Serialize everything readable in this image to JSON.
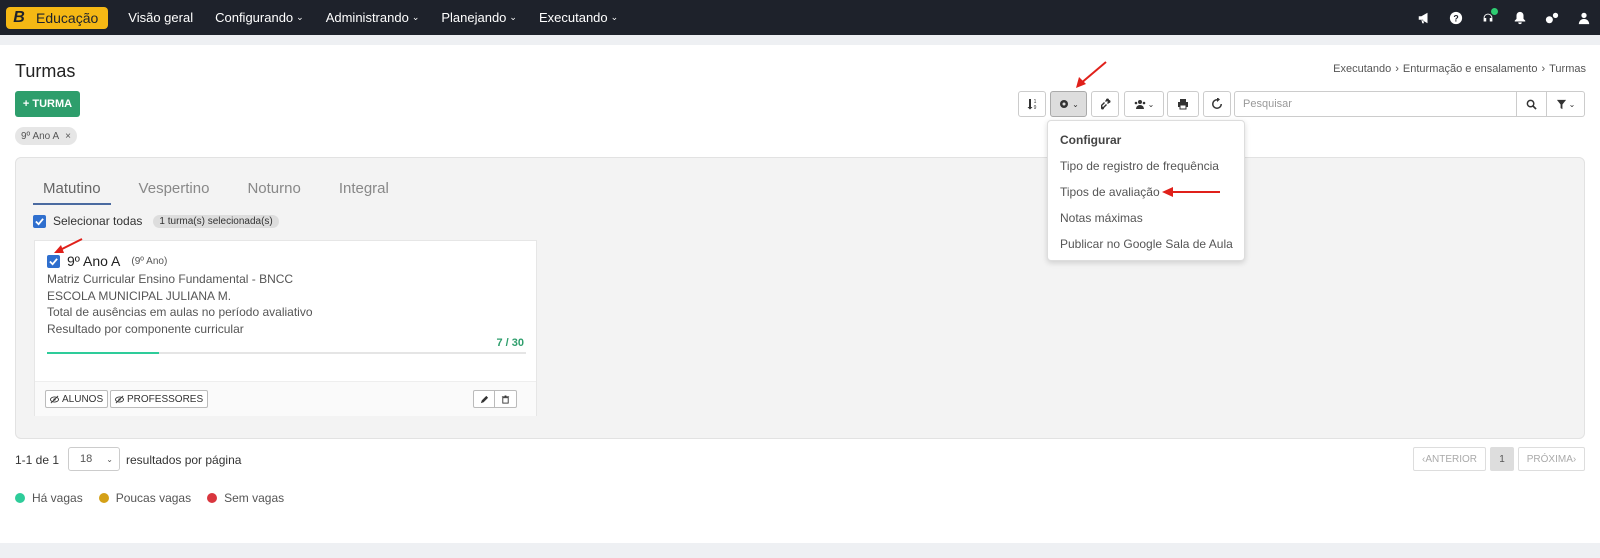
{
  "nav": {
    "logo": "Educação",
    "items": [
      {
        "label": "Visão geral",
        "dropdown": false
      },
      {
        "label": "Configurando",
        "dropdown": true
      },
      {
        "label": "Administrando",
        "dropdown": true
      },
      {
        "label": "Planejando",
        "dropdown": true
      },
      {
        "label": "Executando",
        "dropdown": true
      }
    ],
    "icons": [
      "megaphone-icon",
      "help-icon",
      "support-icon",
      "bell-icon",
      "settings-icon",
      "user-icon"
    ]
  },
  "page": {
    "title": "Turmas",
    "breadcrumb": [
      "Executando",
      "Enturmação e ensalamento",
      "Turmas"
    ],
    "add_button": "TURMA",
    "filter_chip": "9º Ano A"
  },
  "toolbar": {
    "search_placeholder": "Pesquisar"
  },
  "dropdown": {
    "header": "Configurar",
    "items": [
      "Tipo de registro de frequência",
      "Tipos de avaliação",
      "Notas máximas",
      "Publicar no Google Sala de Aula"
    ]
  },
  "tabs": [
    "Matutino",
    "Vespertino",
    "Noturno",
    "Integral"
  ],
  "selection": {
    "select_all_label": "Selecionar todas",
    "selected_badge": "1 turma(s) selecionada(s)"
  },
  "card": {
    "name": "9º Ano A",
    "grade": "(9º Ano)",
    "lines": [
      "Matriz Curricular Ensino Fundamental - BNCC",
      "ESCOLA MUNICIPAL JULIANA M.",
      "Total de ausências em aulas no período avaliativo",
      "Resultado por componente curricular"
    ],
    "count": "7 / 30",
    "progress": 0.233,
    "students_button": "ALUNOS",
    "teachers_button": "PROFESSORES"
  },
  "pagination": {
    "info": "1-1 de 1",
    "per_page": "18",
    "per_page_label": "resultados por página",
    "prev": "ANTERIOR",
    "current": "1",
    "next": "PRÓXIMA"
  },
  "legend": [
    {
      "label": "Há vagas",
      "color": "#2ecc9a"
    },
    {
      "label": "Poucas vagas",
      "color": "#d4a017"
    },
    {
      "label": "Sem vagas",
      "color": "#d9363e"
    }
  ]
}
